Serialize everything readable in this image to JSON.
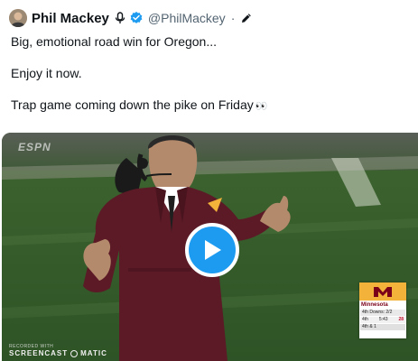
{
  "tweet": {
    "author_name": "Phil Mackey",
    "handle": "@PhilMackey",
    "separator": "·",
    "lines": [
      "Big, emotional road win for Oregon...",
      "Enjoy it now.",
      "Trap game coming down the pike on Friday"
    ],
    "emoji": "👀"
  },
  "video": {
    "network_logo": "ESPN",
    "scorebug": {
      "team": "Minnesota",
      "down_text": "4th Downs: 2/2",
      "quarter": "4th",
      "clock": "5:43",
      "score": "28",
      "down_distance": "4th & 1"
    },
    "watermark_top": "RECORDED WITH",
    "watermark_left": "SCREENCAST",
    "watermark_right": "MATIC"
  },
  "icons": {
    "microphone": "microphone-icon",
    "verified": "verified-badge-icon",
    "edit": "edit-pencil-icon",
    "play": "play-icon"
  },
  "colors": {
    "accent": "#1d9bf0",
    "text": "#0f1419",
    "secondary_text": "#536471",
    "field_green": "#2b4a22",
    "maroon": "#5b1a26",
    "gold": "#f3b23a"
  }
}
